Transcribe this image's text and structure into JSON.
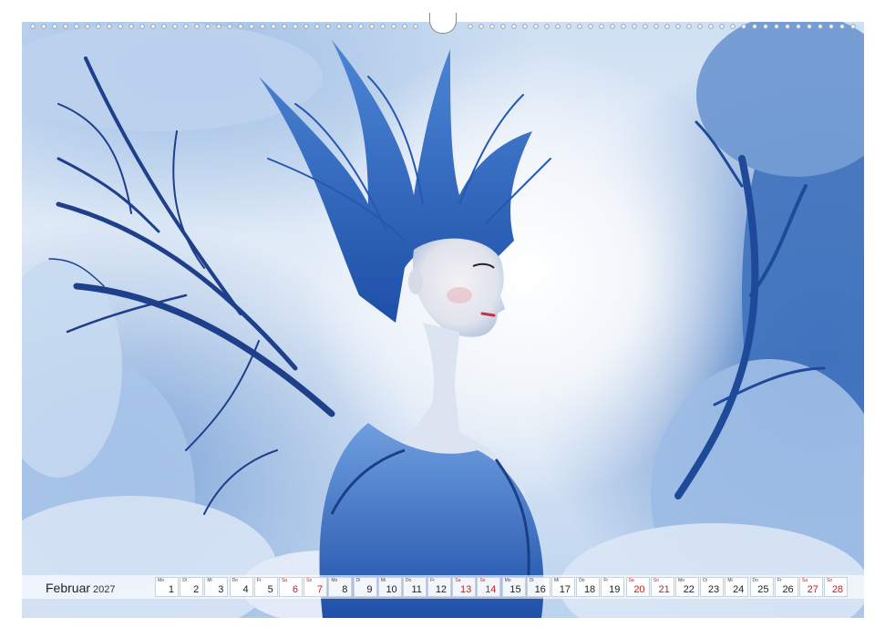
{
  "calendar": {
    "month": "Februar",
    "year": "2027",
    "days": [
      {
        "wd": "Mo",
        "num": "1",
        "we": false
      },
      {
        "wd": "Di",
        "num": "2",
        "we": false
      },
      {
        "wd": "Mi",
        "num": "3",
        "we": false
      },
      {
        "wd": "Do",
        "num": "4",
        "we": false
      },
      {
        "wd": "Fr",
        "num": "5",
        "we": false
      },
      {
        "wd": "Sa",
        "num": "6",
        "we": true
      },
      {
        "wd": "So",
        "num": "7",
        "we": true
      },
      {
        "wd": "Mo",
        "num": "8",
        "we": false
      },
      {
        "wd": "Di",
        "num": "9",
        "we": false
      },
      {
        "wd": "Mi",
        "num": "10",
        "we": false
      },
      {
        "wd": "Do",
        "num": "11",
        "we": false
      },
      {
        "wd": "Fr",
        "num": "12",
        "we": false
      },
      {
        "wd": "Sa",
        "num": "13",
        "we": true
      },
      {
        "wd": "So",
        "num": "14",
        "we": true
      },
      {
        "wd": "Mo",
        "num": "15",
        "we": false
      },
      {
        "wd": "Di",
        "num": "16",
        "we": false
      },
      {
        "wd": "Mi",
        "num": "17",
        "we": false
      },
      {
        "wd": "Do",
        "num": "18",
        "we": false
      },
      {
        "wd": "Fr",
        "num": "19",
        "we": false
      },
      {
        "wd": "Sa",
        "num": "20",
        "we": true
      },
      {
        "wd": "So",
        "num": "21",
        "we": true
      },
      {
        "wd": "Mo",
        "num": "22",
        "we": false
      },
      {
        "wd": "Di",
        "num": "23",
        "we": false
      },
      {
        "wd": "Mi",
        "num": "24",
        "we": false
      },
      {
        "wd": "Do",
        "num": "25",
        "we": false
      },
      {
        "wd": "Fr",
        "num": "26",
        "we": false
      },
      {
        "wd": "Sa",
        "num": "27",
        "we": true
      },
      {
        "wd": "So",
        "num": "28",
        "we": true
      }
    ]
  },
  "colors": {
    "weekend": "#d11a1a",
    "accent_blue": "#1f4fa8"
  }
}
